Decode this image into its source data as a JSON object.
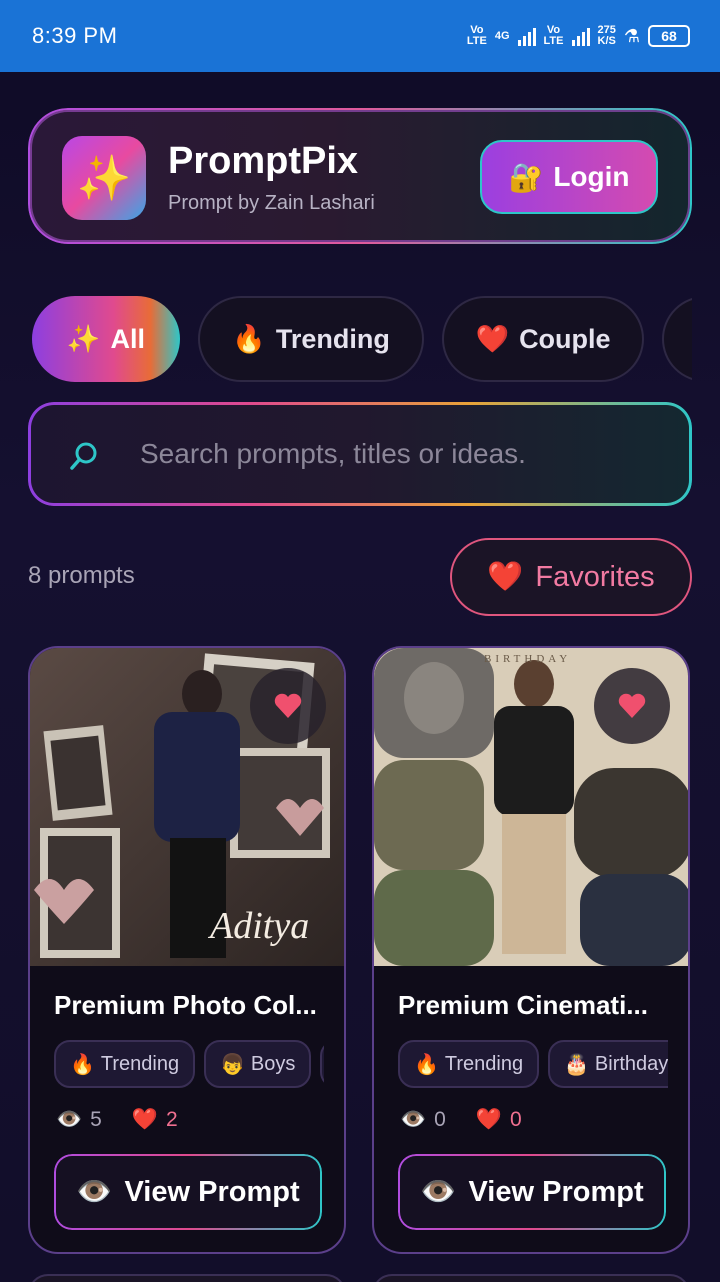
{
  "status_bar": {
    "time": "8:39 PM",
    "volte1": "Vo\nLTE",
    "network": "4G",
    "volte2": "Vo\nLTE",
    "speed_value": "275",
    "speed_unit": "K/S",
    "battery": "68"
  },
  "header": {
    "logo_icon": "sparkles-icon",
    "title": "PromptPix",
    "subtitle": "Prompt by Zain Lashari",
    "login_label": "Login",
    "login_icon": "lock-key-icon"
  },
  "categories": [
    {
      "icon": "✨",
      "label": "All",
      "active": true
    },
    {
      "icon": "🔥",
      "label": "Trending",
      "active": false
    },
    {
      "icon": "❤️",
      "label": "Couple",
      "active": false
    },
    {
      "icon": "",
      "label": "",
      "active": false
    }
  ],
  "search": {
    "placeholder": "Search prompts, titles or ideas."
  },
  "summary": {
    "count_text": "8 prompts",
    "favorites_label": "Favorites"
  },
  "cards": [
    {
      "title": "Premium Photo Col...",
      "image_text": "Aditya",
      "tags": [
        {
          "icon": "🔥",
          "label": "Trending"
        },
        {
          "icon": "👦",
          "label": "Boys"
        }
      ],
      "views": "5",
      "likes": "2",
      "button_label": "View Prompt"
    },
    {
      "title": "Premium Cinemati...",
      "image_text": "BIRTHDAY",
      "tags": [
        {
          "icon": "🔥",
          "label": "Trending"
        },
        {
          "icon": "🎂",
          "label": "Birthday"
        }
      ],
      "views": "0",
      "likes": "0",
      "button_label": "View Prompt"
    }
  ],
  "colors": {
    "accent_purple": "#9b3fe0",
    "accent_pink": "#e04a8e",
    "accent_teal": "#2ec6c8",
    "favorite_red": "#f0506e",
    "status_bar": "#1a73d6"
  }
}
